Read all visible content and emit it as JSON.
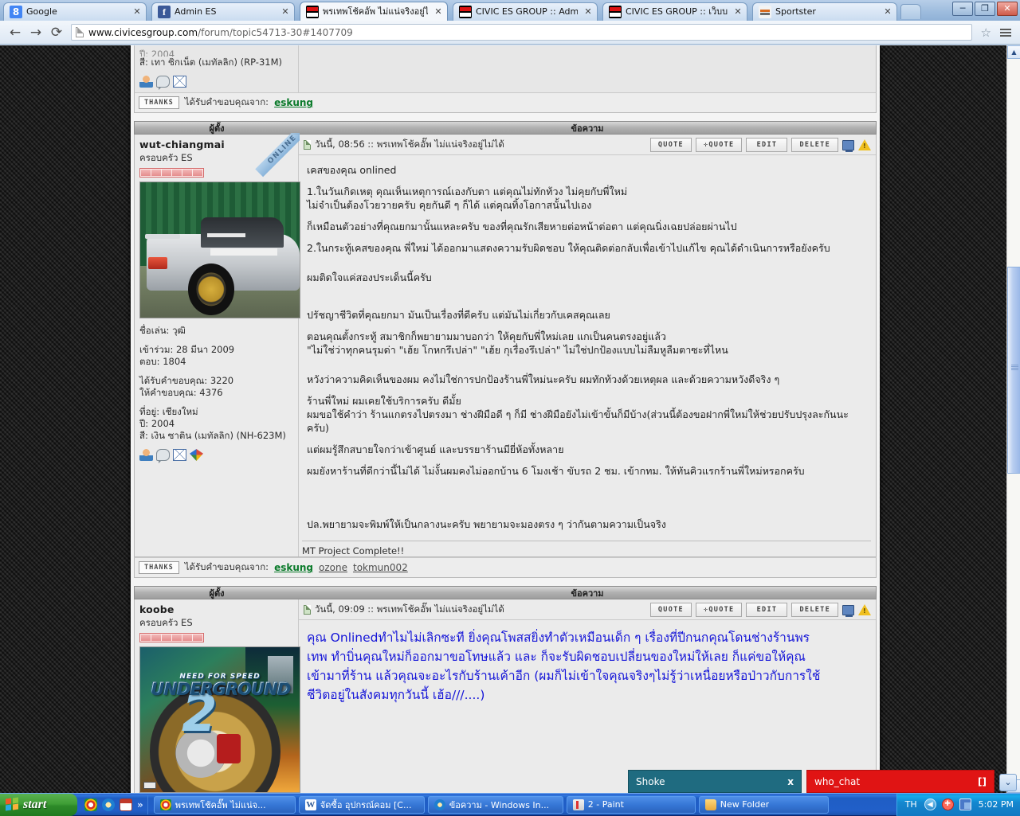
{
  "browser": {
    "tabs": [
      {
        "title": "Google",
        "favicon": "google-icon",
        "active": false
      },
      {
        "title": "Admin ES",
        "favicon": "facebook-icon",
        "active": false
      },
      {
        "title": "พรเทพโช้คอั๊พ ไม่แน่จริงอยู่ไ",
        "favicon": "civic-es-icon",
        "active": true
      },
      {
        "title": "CIVIC ES GROUP :: Admin :",
        "favicon": "civic-es-icon",
        "active": false
      },
      {
        "title": "CIVIC ES GROUP :: เว็บบอร์",
        "favicon": "civic-es-icon",
        "active": false
      },
      {
        "title": "Sportster",
        "favicon": "sportster-icon",
        "active": false
      }
    ],
    "tab_close_label": "✕",
    "nav": {
      "back": "←",
      "forward": "→",
      "reload": "⟳"
    },
    "url_host": "www.civicesgroup.com",
    "url_path": "/forum/topic54713-30#1407709",
    "bookmark_star": "☆",
    "menu_icon": "hamburger-icon",
    "window": {
      "minimize": "─",
      "maximize": "❐",
      "close": "✕"
    }
  },
  "forum": {
    "header": {
      "author_col": "ผู้ตั้ง",
      "message_col": "ข้อความ"
    },
    "prev_post_tail": {
      "color_line": "สี: เทา ซิกเน็ต (เมทัลลิก) (RP-31M)"
    },
    "thanks_label": "THANKS",
    "thanks_prefix": "ได้รับคำขอบคุณจาก:",
    "prev_thanks_users": [
      "eskung"
    ],
    "posts": [
      {
        "author": "wut-chiangmai",
        "rank": "ครอบครัว ES",
        "pips": 6,
        "online_badge": "ONLINE",
        "avatar": "car-photo",
        "stats": {
          "nickname": "ชื่อเล่น: วุฒิ",
          "joined": "เข้าร่วม: 28 มีนา 2009",
          "posts": "ตอบ: 1804",
          "thanks_received": "ได้รับคำขอบคุณ: 3220",
          "thanks_given": "ให้คำขอบคุณ: 4376",
          "location": "ที่อยู่: เชียงใหม่",
          "year": "ปี: 2004",
          "color": "สี: เงิน ซาติน (เมทัลลิก) (NH-623M)"
        },
        "icons": [
          "profile-icon",
          "pm-icon",
          "email-icon",
          "gtalk-icon"
        ],
        "date_line": "วันนี้, 08:56 :: พรเทพโช้คอั๊พ ไม่แน่จริงอยู่ไม่ได้",
        "buttons": [
          "QUOTE",
          "✛QUOTE",
          "EDIT",
          "DELETE"
        ],
        "lines": [
          "เคสของคุณ onlined",
          "",
          "1.ในวันเกิดเหตุ คุณเห็นเหตุการณ์เองกับตา แต่คุณไม่ทักท้วง ไม่คุยกับพี่ใหม่",
          "ไม่จำเป็นต้องโวยวายครับ คุยกันดี ๆ ก็ได้ แต่คุณทิ้งโอกาสนั้นไปเอง",
          "",
          "ก็เหมือนตัวอย่างที่คุณยกมานั้นแหละครับ ของที่คุณรักเสียหายต่อหน้าต่อตา แต่คุณนิ่งเฉยปล่อยผ่านไป",
          "",
          "2.ในกระทู้เคสของคุณ พี่ใหม่ ได้ออกมาแสดงความรับผิดชอบ ให้คุณติดต่อกลับเพื่อเข้าไปแก้ไข คุณได้ดำเนินการหรือยังครับ",
          "",
          "",
          "ผมติดใจแค่สองประเด็นนี้ครับ",
          "",
          "",
          "",
          "ปรัชญาชีวิตที่คุณยกมา มันเป็นเรื่องที่ดีครับ แต่มันไม่เกี่ยวกับเคสคุณเลย",
          "",
          "ตอนคุณตั้งกระทู้ สมาชิกก็พยายามมาบอกว่า ให้คุยกับพี่ใหม่เลย แกเป็นคนตรงอยู่แล้ว",
          "\"ไม่ใช่ว่าทุกคนรุมด่า \"เฮ้ย โกหกรึเปล่า\"  \"เฮ้ย กุเรื่องรึเปล่า\"  ไม่ใช่ปกป้องแบบไม่ลืมหูลืมตาซะที่ไหน",
          "",
          "",
          "หวังว่าความคิดเห็นของผม คงไม่ใช่การปกป้องร้านพี่ใหม่นะครับ ผมทักท้วงด้วยเหตุผล และด้วยความหวังดีจริง ๆ",
          "",
          "ร้านพี่ใหม่ ผมเคยใช้บริการครับ ดีมั้ย",
          "ผมขอใช้คำว่า ร้านแกตรงไปตรงมา ช่างฝีมือดี ๆ ก็มี ช่างฝีมือยังไม่เข้าขั้นก็มีบ้าง(ส่วนนี้ต้องขอฝากพี่ใหม่ให้ช่วยปรับปรุงละกันนะครับ)",
          "",
          "แต่ผมรู้สึกสบายใจกว่าเข้าศูนย์ และบรรยาร้านมียี่ห้อทั้งหลาย",
          "",
          "ผมยังหาร้านที่ดีกว่านี้ไม่ได้ ไม่งั้นผมคงไม่ออกบ้าน 6 โมงเช้า ขับรถ 2 ชม. เข้ากทม. ให้ทันคิวแรกร้านพี่ใหม่หรอกครับ",
          "",
          "",
          "",
          "",
          "ปล.พยายามจะพิมพ์ให้เป็นกลางนะครับ พยายามจะมองตรง ๆ ว่ากันตามความเป็นจริง"
        ],
        "signature": "MT Project Complete!!",
        "thanks_users": [
          "eskung",
          "ozone",
          "tokmun002"
        ]
      },
      {
        "author": "koobe",
        "rank": "ครอบครัว ES",
        "pips": 6,
        "avatar": "nfs-underground-2-cover",
        "date_line": "วันนี้, 09:09 :: พรเทพโช้คอั๊พ ไม่แน่จริงอยู่ไม่ได้",
        "buttons": [
          "QUOTE",
          "✛QUOTE",
          "EDIT",
          "DELETE"
        ],
        "blue_lines": [
          "คุณ Onlinedทำไมไม่เลิกซะที ยิ่งคุณโพสสยิ่งทำตัวเหมือนเด็ก ๆ เรื่องที่ปีกนกคุณโดนช่างร้านพร",
          "เทพ ทำบิ่นคุณใหม่ก็ออกมาขอโทษแล้ว และ ก็จะรับผิดชอบเปลี่ยนของใหม่ให้เลย ก็แค่ขอให้คุณ",
          "เข้ามาที่ร้าน แล้วคุณจะอะไรกับร้านเค้าอีก  (ผมก็ไม่เข้าใจคุณจริงๆไม่รู้ว่าเหนื่อยหรือป่าวกับการใช้",
          "ชีวิตอยู่ในสังคมทุกวันนี้ เฮ้อ///....)"
        ]
      }
    ]
  },
  "chat": {
    "shoke": {
      "title": "Shoke",
      "button": "x",
      "color": "#1f6b80"
    },
    "who_chat": {
      "title": "who_chat",
      "button": "[]",
      "color": "#e01414"
    },
    "caret": "⌄"
  },
  "taskbar": {
    "start_label": "start",
    "quicklaunch": [
      "chrome-icon",
      "ie-icon",
      "calendar-icon"
    ],
    "quicklaunch_more": "»",
    "tasks": [
      {
        "label": "พรเทพโช้คอั๊พ ไม่แน่จ...",
        "icon": "chrome-icon"
      },
      {
        "label": "จัดซื้อ อุปกรณ์คอม [C...",
        "icon": "word-icon"
      },
      {
        "label": "ข้อความ - Windows In...",
        "icon": "ie-icon"
      },
      {
        "label": "2 - Paint",
        "icon": "paint-icon"
      },
      {
        "label": "New Folder",
        "icon": "folder-icon"
      }
    ],
    "language": "TH",
    "tray_icons": [
      "show-hidden-icon",
      "security-shield-icon",
      "network-icon"
    ],
    "clock": "5:02 PM"
  }
}
